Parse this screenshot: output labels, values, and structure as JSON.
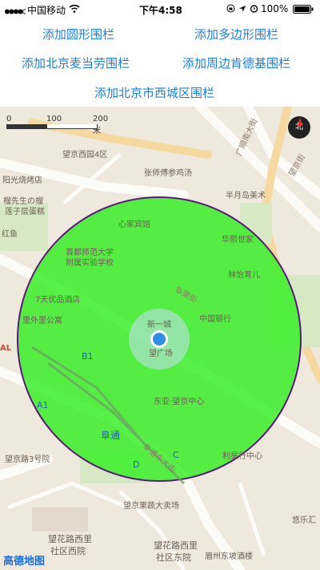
{
  "status_bar": {
    "carrier": "中国移动",
    "time": "下午4:58",
    "battery": "100%",
    "signal_icon": "signal-dots",
    "wifi_icon": "wifi",
    "lock_icon": "orientation-lock",
    "location_icon": "location-arrow",
    "alarm_icon": "alarm-clock"
  },
  "buttons": {
    "circle": "添加圆形围栏",
    "polygon": "添加多边形围栏",
    "mcdonalds": "添加北京麦当劳围栏",
    "kfc": "添加周边肯德基围栏",
    "xicheng": "添加北京市西城区围栏"
  },
  "map": {
    "scale_labels": [
      "0",
      "100",
      "200 米"
    ],
    "compass_label": "北",
    "logo": "高德地图",
    "fence_color": "#33ee22",
    "fence_border_color": "#5a1a7a",
    "location_color": "#2f8fe5",
    "labels": {
      "xiyuan4": "望京西园4区",
      "zhangshi": "张师傅参鸡汤",
      "yangguang": "阳光烧烤店",
      "liuxiansheng": "榴先生の榴",
      "lianzi": "莲子层蛋糕",
      "hongyu": "红鱼",
      "xinke": "心家宾馆",
      "banyue": "半月岛美术",
      "shoudu": "首都师范大学",
      "fushu": "附属实验学校",
      "huaxi": "华熙世家",
      "linpa": "林怡育儿",
      "qitian": "7天优品酒店",
      "liwai": "里外里公寓",
      "wangjing_road_lbl": "望京",
      "xinyicheng": "新一城",
      "zhongguo": "中国银行",
      "guanguang": "望广场",
      "dongya": "东亚·望京中心",
      "futong": "阜通",
      "wangjinglu3": "望京路3号院",
      "lishi": "利星行中心",
      "guozhuan": "望京果蔬大卖场",
      "wanghua": "望花路西里",
      "xiaoqu": "社区西院",
      "wanghuadong": "望花路西里",
      "shequdong": "社区东院",
      "meizhou": "眉州东坡酒楼",
      "yousha": "悠乐汇",
      "street_furong": "阜荣街",
      "street_guangshun": "广顺南大街",
      "street_wangjing": "望京街",
      "street_futong": "阜通东大街",
      "letter_b1": "B1",
      "letter_a1": "A1",
      "letter_c": "C",
      "letter_d": "D",
      "al": "AL"
    }
  }
}
